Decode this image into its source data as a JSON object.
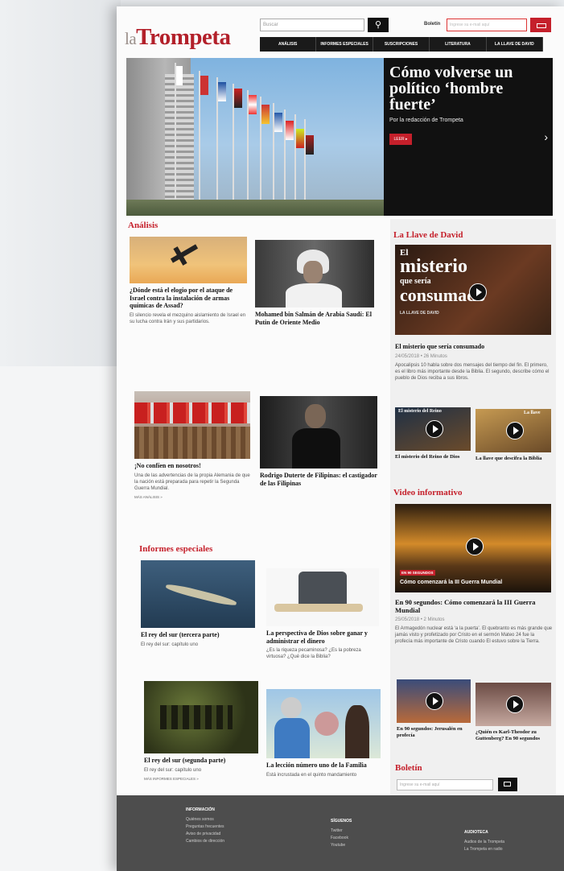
{
  "header": {
    "logo_prefix": "la",
    "logo_main": "Trompeta",
    "search_placeholder": "Buscar",
    "boletin_label": "Boletín",
    "boletin_placeholder": "Ingrese su e-mail aquí",
    "nav": [
      "ANÁLISIS",
      "INFORMES ESPECIALES",
      "SUSCRIPCIONES",
      "LITERATURA",
      "LA LLAVE DE DAVID"
    ]
  },
  "hero": {
    "title": "Cómo volverse un político ‘hombre fuerte’",
    "byline": "Por la redacción de Trompeta",
    "button": "LEER ▸"
  },
  "analisis": {
    "heading": "Análisis",
    "cards": [
      {
        "title": "¿Dónde está el elogio por el ataque de Israel contra la instalación de armas químicas de Assad?",
        "text": "El silencio revela el mezquino aislamiento de Israel en su lucha contra Irán y sus partidarios."
      },
      {
        "title": "Mohamed bin Salmán de Arabia Saudí: El Putin de Oriente Medio",
        "text": ""
      },
      {
        "title": "¡No confíen en nosotros!",
        "text": "Una de las advertencias de la propia Alemania de que la nación está preparada para repetir la Segunda Guerra Mundial.",
        "more": "MÁS ANÁLISIS »"
      },
      {
        "title": "Rodrigo Duterte de Filipinas: el castigador de las Filipinas",
        "text": ""
      }
    ]
  },
  "informes": {
    "heading": "Informes especiales",
    "cards": [
      {
        "title": "El rey del sur (tercera parte)",
        "text": "El rey del sur: capítulo uno"
      },
      {
        "title": "La perspectiva de Dios sobre ganar y administrar el dinero",
        "text": "¿Es la riqueza pecaminosa? ¿Es la pobreza virtuosa? ¿Qué dice la Biblia?"
      },
      {
        "title": "El rey del sur (segunda parte)",
        "text": "El rey del sur: capítulo uno"
      },
      {
        "title": "La lección número uno de la Familia",
        "text": "Está incrustada en el quinto mandamiento"
      }
    ],
    "more": "MÁS INFORMES ESPECIALES »"
  },
  "llave": {
    "heading": "La Llave de David",
    "video_overlay_small": "El",
    "video_overlay_big": "misterio",
    "video_overlay_mid": "que sería",
    "video_overlay_last": "consumado",
    "video_brand": "LA LLAVE DE DAVID",
    "title": "El misterio que sería consumado",
    "meta": "24/05/2018 • 26 Minutos",
    "text": "Apocalipsis 10 habla sobre dos mensajes del tiempo del fin. El primero, es el libro más importante desde la Biblia. El segundo, describe cómo el pueblo de Dios reciba a sus libros.",
    "small": [
      {
        "title": "El misterio del Reino de Dios",
        "overlay": "El misterio del Reino"
      },
      {
        "title": "La llave que descifra la Biblia",
        "overlay": "La llave"
      }
    ]
  },
  "video": {
    "heading": "Video informativo",
    "banner": "Cómo comenzará la III Guerra Mundial",
    "tag": "EN 90 SEGUNDOS",
    "title": "En 90 segundos: Cómo comenzará la III Guerra Mundial",
    "meta": "25/05/2018 • 2 Minutos",
    "text": "El Armagedón nuclear está ‘a la puerta’. El quebranto es más grande que jamás visto y profetizado por Cristo en el sermón Mateo 24 fue la profecía más importante de Cristo cuando El estuvo sobre la Tierra.",
    "small": [
      {
        "title": "En 90 segundos: Jerusalén en profecía"
      },
      {
        "title": "¿Quién es Karl-Theodor zu Guttenberg? En 90 segundos"
      }
    ]
  },
  "boletin": {
    "heading": "Boletín",
    "placeholder": "Ingrese su e-mail aquí"
  },
  "footer": {
    "cols": [
      {
        "heading": "INFORMACIÓN",
        "items": [
          "Quiénes somos",
          "Preguntas frecuentes",
          "Aviso de privacidad",
          "Cambios de dirección"
        ]
      },
      {
        "heading": "SÍGUENOS",
        "items": [
          "Twitter",
          "Facebook",
          "Youtube"
        ]
      },
      {
        "heading": "AUDIOTECA",
        "items": [
          "Audios de la Trompeta",
          "La Trompeta en radio"
        ]
      }
    ]
  },
  "colors": {
    "accent": "#c5202b",
    "dark": "#111111",
    "footer": "#4d4d4d"
  }
}
